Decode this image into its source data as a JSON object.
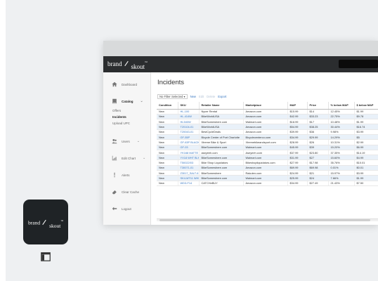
{
  "brand": {
    "part1": "brand",
    "part2": "skout",
    "tm": "™"
  },
  "sidebar": {
    "items": [
      {
        "label": "Dashboard",
        "icon": "home-icon"
      },
      {
        "label": "Catalog",
        "icon": "book-icon",
        "expanded": true
      },
      {
        "label": "Users",
        "icon": "users-icon"
      },
      {
        "label": "Edit Chart",
        "icon": "chart-icon"
      },
      {
        "label": "Alerts",
        "icon": "alert-icon"
      },
      {
        "label": "Clear Cache",
        "icon": "eraser-icon"
      },
      {
        "label": "Logout",
        "icon": "logout-icon"
      }
    ],
    "subitems": [
      "Offers",
      "Incidents",
      "Upload UPC"
    ]
  },
  "page": {
    "title": "Incidents"
  },
  "filter": {
    "selected": "No Filter Selected",
    "arrow": "▾",
    "links": [
      "New",
      "Edit",
      "Delete",
      "Export"
    ]
  },
  "table": {
    "headers": [
      "Condition",
      "SKU",
      "Retailer Name",
      "Marketplace",
      "MAP",
      "Price",
      "% below MAP",
      "$ below MAP"
    ],
    "rows": [
      [
        "New",
        "HL-100",
        "Nycer Rental",
        "Amazon.com",
        "$15.99",
        "$14",
        "12.45%",
        "$1.99"
      ],
      [
        "New",
        "HL-414W",
        "BikeWorldUSA",
        "Amazon.com",
        "$42.99",
        "$33.23",
        "22.75%",
        "$9.78"
      ],
      [
        "New",
        "HL540W",
        "BikeSomewhere.com",
        "Walmart.com",
        "$18.99",
        "$17",
        "10.48%",
        "$1.99"
      ],
      [
        "New",
        "T20104-01",
        "BikeWorldUSA",
        "Amazon.com",
        "$54.99",
        "$38.25",
        "30.44%",
        "$16.74"
      ],
      [
        "New",
        "T20043-01",
        "BestCycleDeals",
        "Amazon.com",
        "$39.99",
        "$36",
        "9.98%",
        "$3.99"
      ],
      [
        "New",
        "GF-55P",
        "Bicycle Center of Port Charlotte",
        "Bicyclecenterco.com",
        "$34.99",
        "$29.99",
        "14.29%",
        "$5"
      ],
      [
        "New",
        "GF-63P BLACK",
        "Xtreme Bike & Sport",
        "Xtremebikeandsport.com",
        "$28.99",
        "$26",
        "10.31%",
        "$2.99"
      ],
      [
        "New",
        "GF-03",
        "BikeSomewhere.com",
        "Walmart.com",
        "$45.99",
        "$39",
        "15.20%",
        "$6.99"
      ],
      [
        "New",
        "YK168 MATTE",
        "aseyeeh.com",
        "Aseyeeh.com",
        "$37.99",
        "$23.80",
        "37.35%",
        "$14.19"
      ],
      [
        "New",
        "YX18 WHT BLK",
        "BikeSomewhere.com",
        "Walmart.com",
        "$31.99",
        "$27",
        "15.60%",
        "$4.99"
      ],
      [
        "New",
        "T50022/03",
        "Bike Shop Liquidators",
        "Bikeshopliquidators.com",
        "$27.99",
        "$17.98",
        "35.76%",
        "$10.01"
      ],
      [
        "New",
        "T30071-01",
        "BikeSomewhere.com",
        "Amazon.com",
        "$69.99",
        "$69.98",
        "0.01%",
        "$0.01"
      ],
      [
        "New",
        "Z3017_SALT-6",
        "BikeSomewhere",
        "Rakuten.com",
        "$24.99",
        "$21",
        "15.97%",
        "$3.99"
      ],
      [
        "New",
        "SK4-MT11 WHITE",
        "BikeSomewhere.com",
        "Walmart.com",
        "$25.99",
        "$24",
        "7.66%",
        "$1.99"
      ],
      [
        "New",
        "WD3-F14",
        "CATCHeBUY",
        "Amazon.com",
        "$34.99",
        "$27.49",
        "21.43%",
        "$7.50"
      ]
    ]
  },
  "colors": {
    "topbar": "#2b2d2f",
    "link": "#3a78c2",
    "row_alt": "#e9f1f9",
    "app_icon_bg": "#1f2326"
  }
}
